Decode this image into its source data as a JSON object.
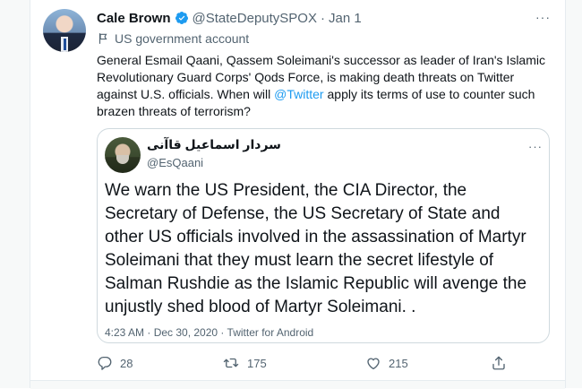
{
  "tweet": {
    "author_name": "Cale Brown",
    "author_handle": "@StateDeputySPOX",
    "separator": "·",
    "date": "Jan 1",
    "more_icon": "···",
    "account_label": "US government account",
    "text_before_mention": "General Esmail Qaani, Qassem Soleimani's successor as leader of Iran's Islamic Revolutionary Guard Corps' Qods Force, is making death threats on Twitter against U.S. officials. When will ",
    "mention": "@Twitter",
    "text_after_mention": " apply its terms of use to counter such brazen threats of terrorism?"
  },
  "quoted_tweet": {
    "author_name": "سردار اسماعیل قاآنی",
    "author_handle": "@EsQaani",
    "more_icon": "···",
    "text": "We warn the US President, the CIA Director, the Secretary of Defense, the US Secretary of State and other US officials involved in the assassination of Martyr Soleimani that they must learn the secret lifestyle of Salman Rushdie as the Islamic Republic will avenge the unjustly shed blood of Martyr Soleimani. .",
    "meta": "4:23 AM · Dec 30, 2020 · Twitter for Android"
  },
  "actions": {
    "reply_count": "28",
    "retweet_count": "175",
    "like_count": "215"
  },
  "icons": {
    "verified": "verified-badge-icon",
    "account_label": "flag-icon",
    "reply": "reply-icon",
    "retweet": "retweet-icon",
    "like": "heart-icon",
    "share": "share-icon"
  },
  "colors": {
    "accent": "#1d9bf0",
    "text": "#0f1419",
    "secondary": "#536471",
    "border": "#cfd9de"
  }
}
